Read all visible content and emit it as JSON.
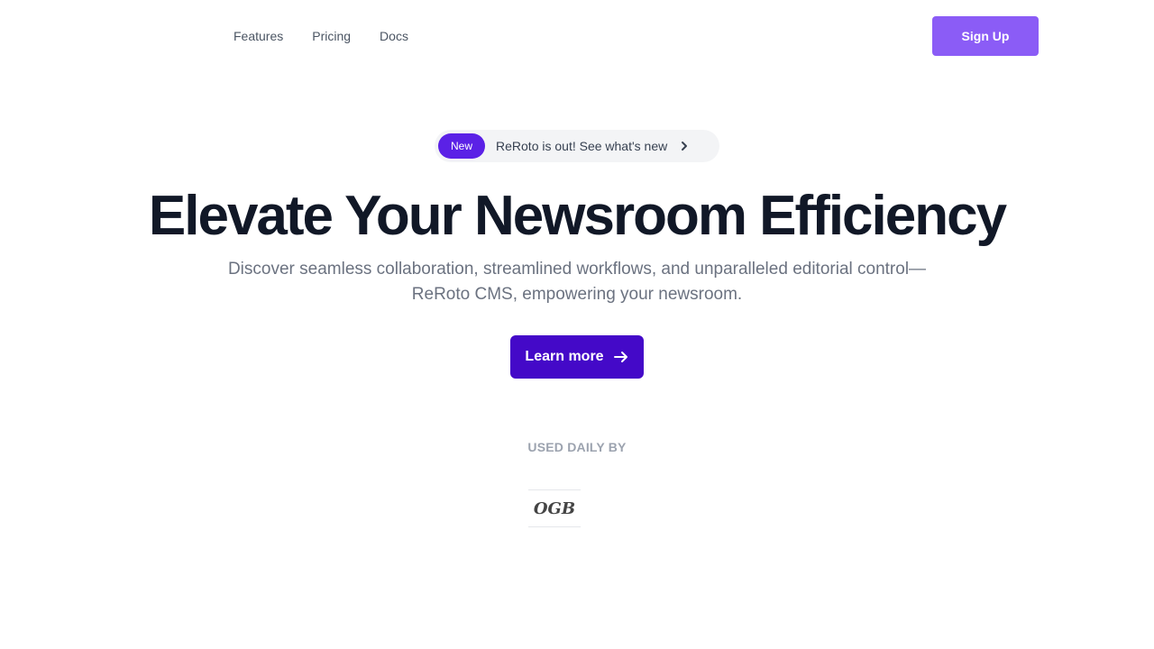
{
  "nav": {
    "links": [
      "Features",
      "Pricing",
      "Docs"
    ],
    "signup_label": "Sign Up"
  },
  "announcement": {
    "badge": "New",
    "text": "ReRoto is out! See what's new",
    "icon": "chevron-right-icon"
  },
  "hero": {
    "title": "Elevate Your Newsroom Efficiency",
    "subtitle": "Discover seamless collaboration, streamlined workflows, and unparalleled editorial control—ReRoto CMS, empowering your newsroom.",
    "cta_label": "Learn more",
    "cta_icon": "arrow-right-icon"
  },
  "customers": {
    "label": "USED DAILY BY",
    "logo_text": "OGB"
  },
  "colors": {
    "signup": "#8b5cf6",
    "badge": "#5b21e6",
    "cta": "#4409c8",
    "title": "#111827",
    "muted": "#6b7280"
  }
}
